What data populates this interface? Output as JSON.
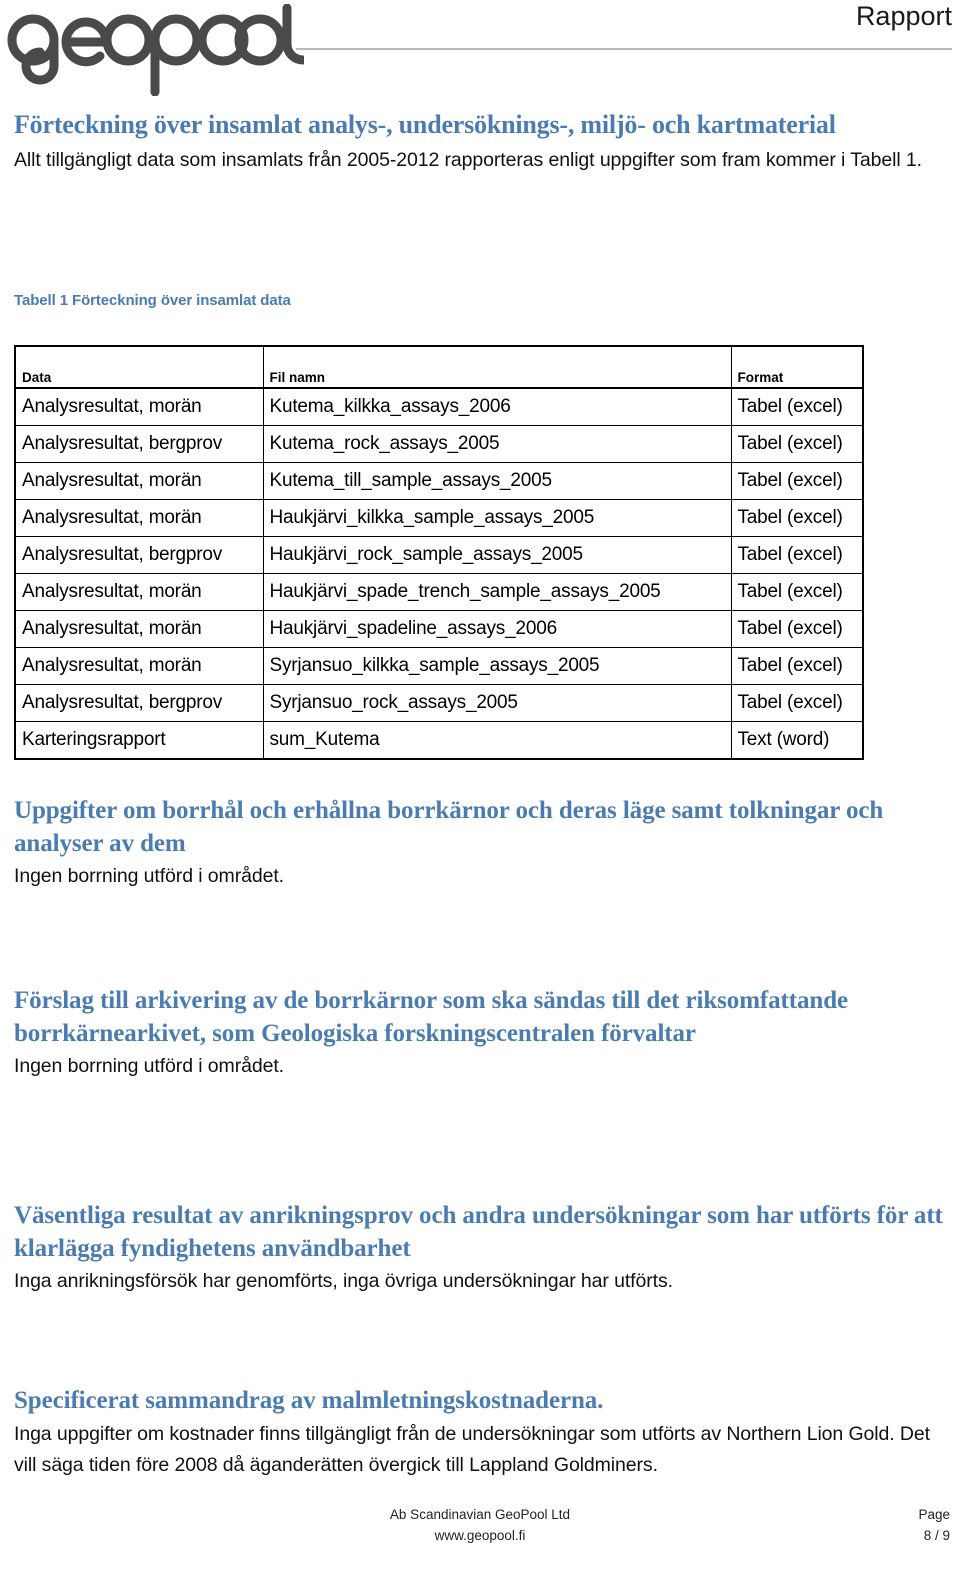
{
  "header": {
    "document_type": "Rapport",
    "logo_text": "geopool",
    "logo_color": "#4a4a4d",
    "rule_color": "#b9b9b9"
  },
  "theme": {
    "heading_blue": "#4b7cb0",
    "body_black": "#111111",
    "table_border": "#000000"
  },
  "intro": {
    "title": "Förteckning över insamlat analys-, undersöknings-, miljö- och kartmaterial",
    "paragraph": "Allt tillgängligt data som insamlats från 2005-2012 rapporteras enligt uppgifter som fram kommer i Tabell 1."
  },
  "table": {
    "caption": "Tabell 1 Förteckning över insamlat data",
    "columns": [
      "Data",
      "Fil namn",
      "Format"
    ],
    "rows": [
      [
        "Analysresultat, morän",
        "Kutema_kilkka_assays_2006",
        "Tabel (excel)"
      ],
      [
        "Analysresultat, bergprov",
        "Kutema_rock_assays_2005",
        "Tabel (excel)"
      ],
      [
        "Analysresultat, morän",
        "Kutema_till_sample_assays_2005",
        "Tabel (excel)"
      ],
      [
        "Analysresultat, morän",
        "Haukjärvi_kilkka_sample_assays_2005",
        "Tabel (excel)"
      ],
      [
        "Analysresultat, bergprov",
        "Haukjärvi_rock_sample_assays_2005",
        "Tabel (excel)"
      ],
      [
        "Analysresultat, morän",
        "Haukjärvi_spade_trench_sample_assays_2005",
        "Tabel (excel)"
      ],
      [
        "Analysresultat, morän",
        "Haukjärvi_spadeline_assays_2006",
        "Tabel (excel)"
      ],
      [
        "Analysresultat, morän",
        "Syrjansuo_kilkka_sample_assays_2005",
        "Tabel (excel)"
      ],
      [
        "Analysresultat, bergprov",
        "Syrjansuo_rock_assays_2005",
        "Tabel (excel)"
      ],
      [
        "Karteringsrapport",
        "sum_Kutema",
        "Text (word)"
      ]
    ]
  },
  "sections": {
    "borrhal": {
      "heading": "Uppgifter om borrhål och erhållna borrkärnor och deras läge samt tolkningar och analyser av dem",
      "body": "Ingen borrning utförd i området."
    },
    "forslag": {
      "heading": "Förslag till arkivering av de borrkärnor som ska sändas till det riksomfattande borrkärnearkivet, som Geologiska forskningscentralen förvaltar",
      "body": "Ingen borrning utförd i området."
    },
    "resultat": {
      "heading": "Väsentliga resultat av anrikningsprov och andra undersökningar som har utförts för att klarlägga fyndighetens användbarhet",
      "body": "Inga anrikningsförsök har genomförts, inga övriga undersökningar har utförts."
    },
    "kostnader": {
      "heading": "Specificerat sammandrag av malmletningskostnaderna.",
      "body": "Inga uppgifter om kostnader finns tillgängligt från de undersökningar som utförts av Northern Lion Gold. Det vill säga tiden före 2008 då äganderätten övergick till Lappland Goldminers."
    }
  },
  "footer": {
    "company": "Ab Scandinavian GeoPool Ltd",
    "website": "www.geopool.fi",
    "page_label": "Page",
    "page_number": "8 / 9"
  }
}
